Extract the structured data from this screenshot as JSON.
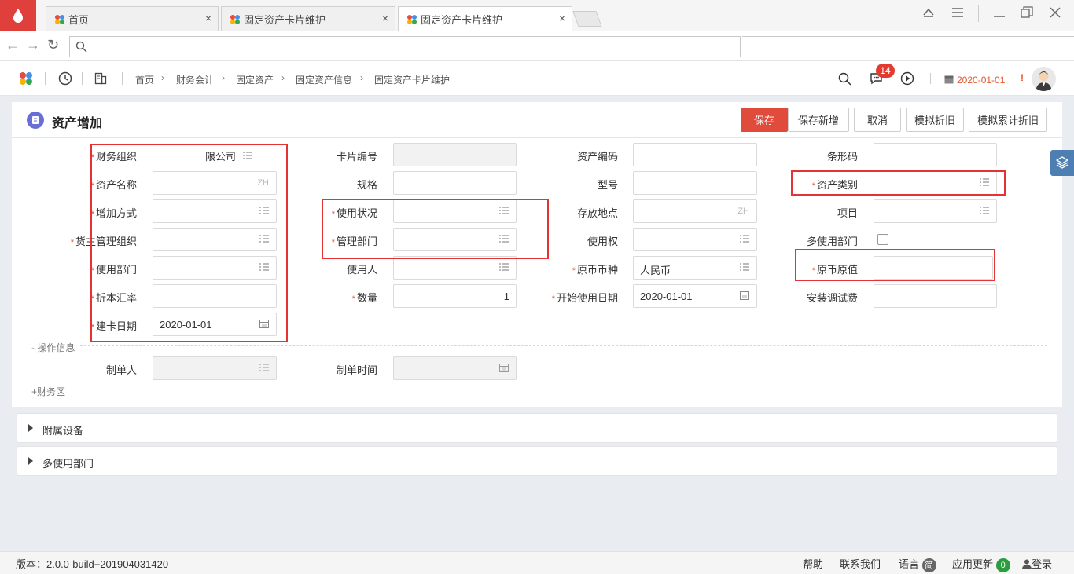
{
  "browser": {
    "tabs": [
      {
        "label": "首页"
      },
      {
        "label": "固定资产卡片维护"
      },
      {
        "label": "固定资产卡片维护"
      }
    ],
    "close_glyph": "×",
    "url": "",
    "nav": {
      "back": "←",
      "forward": "→",
      "reload": "↻"
    }
  },
  "app": {
    "breadcrumb": [
      "首页",
      "财务会计",
      "固定资产",
      "固定资产信息",
      "固定资产卡片维护"
    ],
    "message_count": "14",
    "business_date": "2020-01-01",
    "alert_mark": "!"
  },
  "page": {
    "title": "资产增加",
    "buttons": {
      "save": "保存",
      "save_new": "保存新增",
      "cancel": "取消",
      "sim_depr": "模拟折旧",
      "sim_accum_depr": "模拟累计折旧"
    }
  },
  "form": {
    "fin_org": {
      "label": "财务组织",
      "value": "限公司"
    },
    "card_no": {
      "label": "卡片编号"
    },
    "asset_code": {
      "label": "资产编码"
    },
    "barcode": {
      "label": "条形码"
    },
    "asset_name": {
      "label": "资产名称",
      "lang": "ZH"
    },
    "spec": {
      "label": "规格"
    },
    "model": {
      "label": "型号"
    },
    "asset_category": {
      "label": "资产类别"
    },
    "add_method": {
      "label": "增加方式"
    },
    "usage_status": {
      "label": "使用状况"
    },
    "location": {
      "label": "存放地点",
      "lang": "ZH"
    },
    "project": {
      "label": "项目"
    },
    "owner_org": {
      "label": "货主管理组织"
    },
    "mgmt_dept": {
      "label": "管理部门"
    },
    "use_right": {
      "label": "使用权"
    },
    "multi_dept_flag": {
      "label": "多使用部门"
    },
    "use_dept": {
      "label": "使用部门"
    },
    "user": {
      "label": "使用人"
    },
    "currency": {
      "label": "原币币种",
      "value": "人民币"
    },
    "orig_value": {
      "label": "原币原值"
    },
    "exchange_rate": {
      "label": "折本汇率"
    },
    "quantity": {
      "label": "数量",
      "value": "1"
    },
    "start_date": {
      "label": "开始使用日期",
      "value": "2020-01-01"
    },
    "install_fee": {
      "label": "安装调试费"
    },
    "card_date": {
      "label": "建卡日期",
      "value": "2020-01-01"
    },
    "creator": {
      "label": "制单人"
    },
    "create_time": {
      "label": "制单时间"
    }
  },
  "sections": {
    "ops_info": "- 操作信息",
    "finance": "+财务区"
  },
  "panels": [
    {
      "label": "附属设备"
    },
    {
      "label": "多使用部门"
    }
  ],
  "footer": {
    "version": "版本：2.0.0-build+201904031420",
    "help": "帮助",
    "contact": "联系我们",
    "language": "语言",
    "language_badge": "简",
    "updates": "应用更新",
    "updates_count": "0",
    "login": "登录"
  },
  "colors": {
    "primary": "#e14b3c",
    "highlight_box": "#e53232",
    "badge": "#e23b2f",
    "date": "#e4552d",
    "side_tab": "#4d7fb3"
  },
  "icons": [
    "app-logo-icon",
    "history-icon",
    "building-icon",
    "search-icon",
    "message-icon",
    "play-icon",
    "calendar-icon",
    "list-icon",
    "layers-icon",
    "user-icon"
  ]
}
